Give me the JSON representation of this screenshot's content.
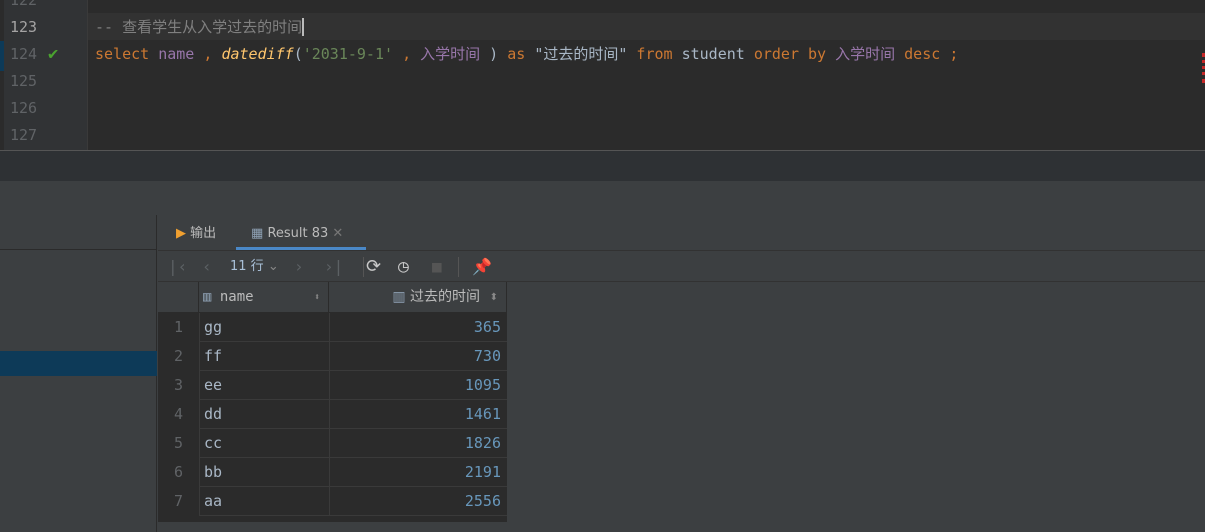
{
  "editor": {
    "line_numbers": [
      "122",
      "123",
      "124",
      "125",
      "126",
      "127"
    ],
    "comment": "-- 查看学生从入学过去的时间",
    "sql": {
      "select": "select",
      "name": "name",
      "comma": ",",
      "fn": "datediff",
      "lp": "(",
      "date": "'2031-9-1'",
      "col": "入学时间",
      "rp": ")",
      "as": "as",
      "alias": "\"过去的时间\"",
      "from": "from",
      "table": "student",
      "order": "order",
      "by": "by",
      "col2": "入学时间",
      "desc": "desc",
      "semi": ";"
    }
  },
  "tabs": [
    {
      "label": "输出",
      "icon": "output-icon"
    },
    {
      "label": "Result 83",
      "icon": "table-icon",
      "active": true
    }
  ],
  "toolbar": {
    "rows_label": "11 行"
  },
  "table": {
    "columns": [
      "name",
      "过去的时间"
    ],
    "rows": [
      {
        "n": "1",
        "name": "gg",
        "days": "365"
      },
      {
        "n": "2",
        "name": "ff",
        "days": "730"
      },
      {
        "n": "3",
        "name": "ee",
        "days": "1095"
      },
      {
        "n": "4",
        "name": "dd",
        "days": "1461"
      },
      {
        "n": "5",
        "name": "cc",
        "days": "1826"
      },
      {
        "n": "6",
        "name": "bb",
        "days": "2191"
      },
      {
        "n": "7",
        "name": "aa",
        "days": "2556"
      }
    ]
  }
}
